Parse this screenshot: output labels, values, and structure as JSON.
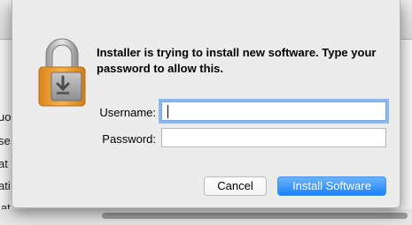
{
  "background": {
    "sidebar_fragments": [
      "uo",
      "se",
      "at",
      "ati",
      "lat"
    ]
  },
  "dialog": {
    "message": "Installer is trying to install new software. Type your password to allow this.",
    "username_label": "Username:",
    "username_value": "",
    "password_label": "Password:",
    "password_value": "",
    "cancel_label": "Cancel",
    "install_label": "Install Software",
    "icon": "padlock-installer-icon",
    "accent_color": "#1a82fb"
  }
}
